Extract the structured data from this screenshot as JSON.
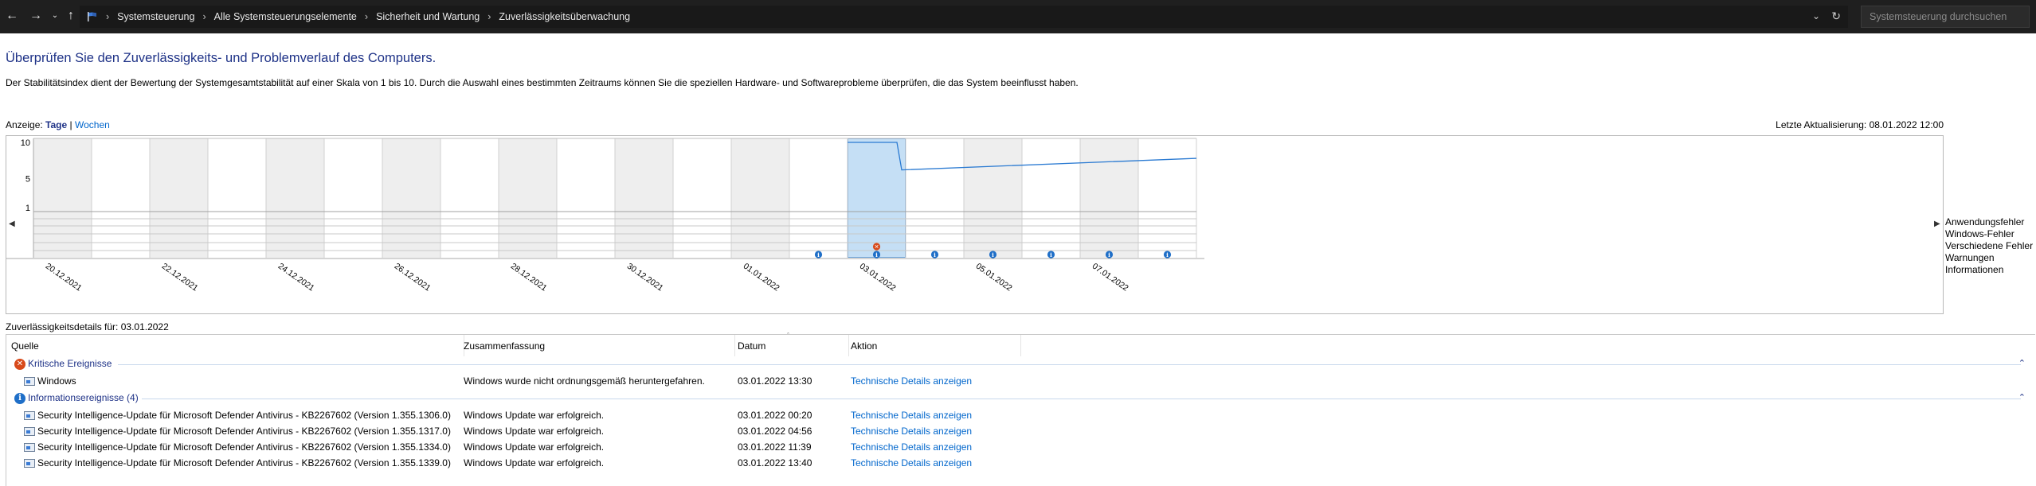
{
  "breadcrumbs": [
    "Systemsteuerung",
    "Alle Systemsteuerungselemente",
    "Sicherheit und Wartung",
    "Zuverlässigkeitsüberwachung"
  ],
  "search": {
    "placeholder": "Systemsteuerung durchsuchen"
  },
  "page": {
    "title": "Überprüfen Sie den Zuverlässigkeits- und Problemverlauf des Computers.",
    "description": "Der Stabilitätsindex dient der Bewertung der Systemgesamtstabilität auf einer Skala von 1 bis 10. Durch die Auswahl eines bestimmten Zeitraums können Sie die speziellen Hardware- und Softwareprobleme überprüfen, die das System beeinflusst haben.",
    "view_label": "Anzeige:",
    "view_days": "Tage",
    "view_sep": "|",
    "view_weeks": "Wochen",
    "last_update": "Letzte Aktualisierung: 08.01.2022 12:00"
  },
  "chart_data": {
    "type": "line",
    "y_ticks": [
      "10",
      "5",
      "1"
    ],
    "ylim": [
      1,
      10
    ],
    "x_labels": [
      "20.12.2021",
      "22.12.2021",
      "24.12.2021",
      "26.12.2021",
      "28.12.2021",
      "30.12.2021",
      "01.01.2022",
      "03.01.2022",
      "05.01.2022",
      "07.01.2022"
    ],
    "dates": [
      "20.12.2021",
      "21.12.2021",
      "22.12.2021",
      "23.12.2021",
      "24.12.2021",
      "25.12.2021",
      "26.12.2021",
      "27.12.2021",
      "28.12.2021",
      "29.12.2021",
      "30.12.2021",
      "31.12.2021",
      "01.01.2022",
      "02.01.2022",
      "03.01.2022",
      "04.01.2022",
      "05.01.2022",
      "06.01.2022",
      "07.01.2022",
      "08.01.2022"
    ],
    "weekend_columns": [
      0,
      2,
      4,
      6,
      8,
      10,
      12,
      16,
      18
    ],
    "selected": "03.01.2022",
    "stability_index": [
      {
        "date": "03.01.2022",
        "value": 10,
        "pos": "start"
      },
      {
        "date": "03.01.2022",
        "value": 10,
        "pos": "before-event"
      },
      {
        "date": "03.01.2022",
        "value": 6.2,
        "pos": "after-event"
      },
      {
        "date": "08.01.2022",
        "value": 7.8,
        "pos": "end"
      }
    ],
    "legend": [
      "Anwendungsfehler",
      "Windows-Fehler",
      "Verschiedene Fehler",
      "Warnungen",
      "Informationen"
    ],
    "events": {
      "Verschiedene Fehler": [
        "03.01.2022"
      ],
      "Informationen": [
        "02.01.2022",
        "03.01.2022",
        "04.01.2022",
        "05.01.2022",
        "06.01.2022",
        "07.01.2022",
        "08.01.2022"
      ]
    }
  },
  "details": {
    "label": "Zuverlässigkeitsdetails für: 03.01.2022",
    "columns": [
      "Quelle",
      "Zusammenfassung",
      "Datum",
      "Aktion"
    ],
    "groups": [
      {
        "title": "Kritische Ereignisse",
        "icon": "error-icon",
        "rows": [
          {
            "source": "Windows",
            "summary": "Windows wurde nicht ordnungsgemäß heruntergefahren.",
            "date": "03.01.2022 13:30",
            "action": "Technische Details anzeigen"
          }
        ]
      },
      {
        "title": "Informationsereignisse (4)",
        "icon": "info-icon",
        "rows": [
          {
            "source": "Security Intelligence-Update für Microsoft Defender Antivirus - KB2267602 (Version 1.355.1306.0)",
            "summary": "Windows Update war erfolgreich.",
            "date": "03.01.2022 00:20",
            "action": "Technische Details anzeigen"
          },
          {
            "source": "Security Intelligence-Update für Microsoft Defender Antivirus - KB2267602 (Version 1.355.1317.0)",
            "summary": "Windows Update war erfolgreich.",
            "date": "03.01.2022 04:56",
            "action": "Technische Details anzeigen"
          },
          {
            "source": "Security Intelligence-Update für Microsoft Defender Antivirus - KB2267602 (Version 1.355.1334.0)",
            "summary": "Windows Update war erfolgreich.",
            "date": "03.01.2022 11:39",
            "action": "Technische Details anzeigen"
          },
          {
            "source": "Security Intelligence-Update für Microsoft Defender Antivirus - KB2267602 (Version 1.355.1339.0)",
            "summary": "Windows Update war erfolgreich.",
            "date": "03.01.2022 13:40",
            "action": "Technische Details anzeigen"
          }
        ]
      }
    ]
  },
  "colors": {
    "title": "#1e3287",
    "link": "#0066cc",
    "selection": "#c5dff5",
    "line": "#2a7ad2",
    "weekend": "#eeeeee",
    "error": "#d84a1b",
    "info": "#1f6fc8"
  }
}
